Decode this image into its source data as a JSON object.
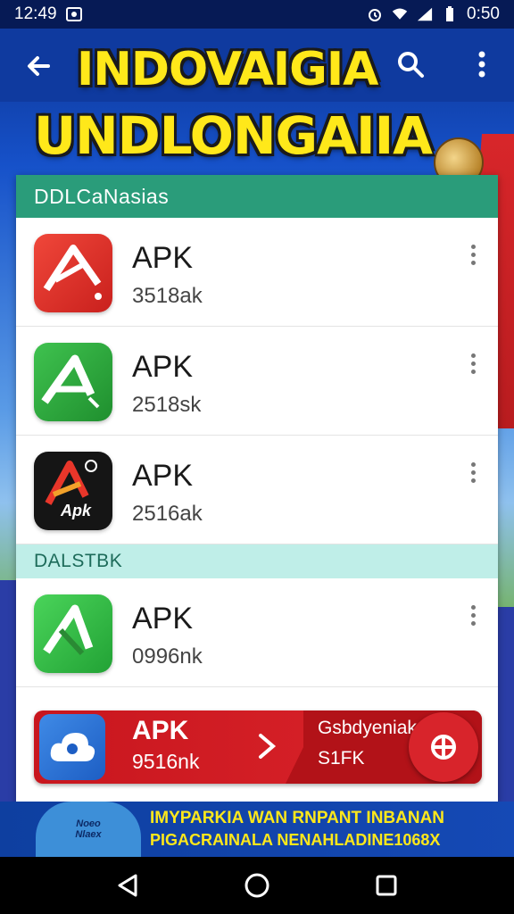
{
  "status_bar": {
    "time": "12:49",
    "clock": "0:50",
    "icons": [
      "screenshot-icon",
      "alarm-icon",
      "wifi-icon",
      "signal-icon",
      "battery-icon"
    ]
  },
  "app_bar": {
    "headline_line1": "INDOVAIGIA",
    "headline_line2": "UNDLONGAIIA",
    "icons": [
      "back-arrow-icon",
      "search-icon",
      "more-vert-icon"
    ]
  },
  "sections": [
    {
      "header": "DDLCaNasias",
      "items": [
        {
          "title": "APK",
          "size": "3518ak",
          "icon": "red-a-app-icon",
          "icon_color": "#e0312b"
        },
        {
          "title": "APK",
          "size": "2518sk",
          "icon": "green-a-app-icon",
          "icon_color": "#2aa33a"
        },
        {
          "title": "APK",
          "size": "2516ak",
          "icon": "black-apk-app-icon",
          "icon_color": "#151515",
          "icon_label": "Apk"
        }
      ]
    },
    {
      "header": "DALSTBK",
      "items": [
        {
          "title": "APK",
          "size": "0996nk",
          "icon": "green-a-app-icon",
          "icon_color": "#34b847"
        }
      ]
    }
  ],
  "promo": {
    "title": "APK",
    "size": "9516nk",
    "right_line1": "Gsbdyeniak",
    "right_line2": "S1FK",
    "icon": "cloud-app-icon",
    "action_icon": "globe-icon"
  },
  "ad": {
    "badge_line1": "Noeo",
    "badge_line2": "Nlaex",
    "line1": "IMYPARKIA WAN RNPANT INBANAN",
    "line2": "PIGACRAINALA NENAHLADINE1068X"
  },
  "nav": {
    "icons": [
      "back-triangle-icon",
      "home-circle-icon",
      "recents-square-icon"
    ]
  },
  "colors": {
    "headline": "#ffe81a",
    "app_bar": "#0f3a9f",
    "section_header": "#2a9c7a",
    "section_header_light": "#bfeee8",
    "promo_red": "#d41f26"
  }
}
